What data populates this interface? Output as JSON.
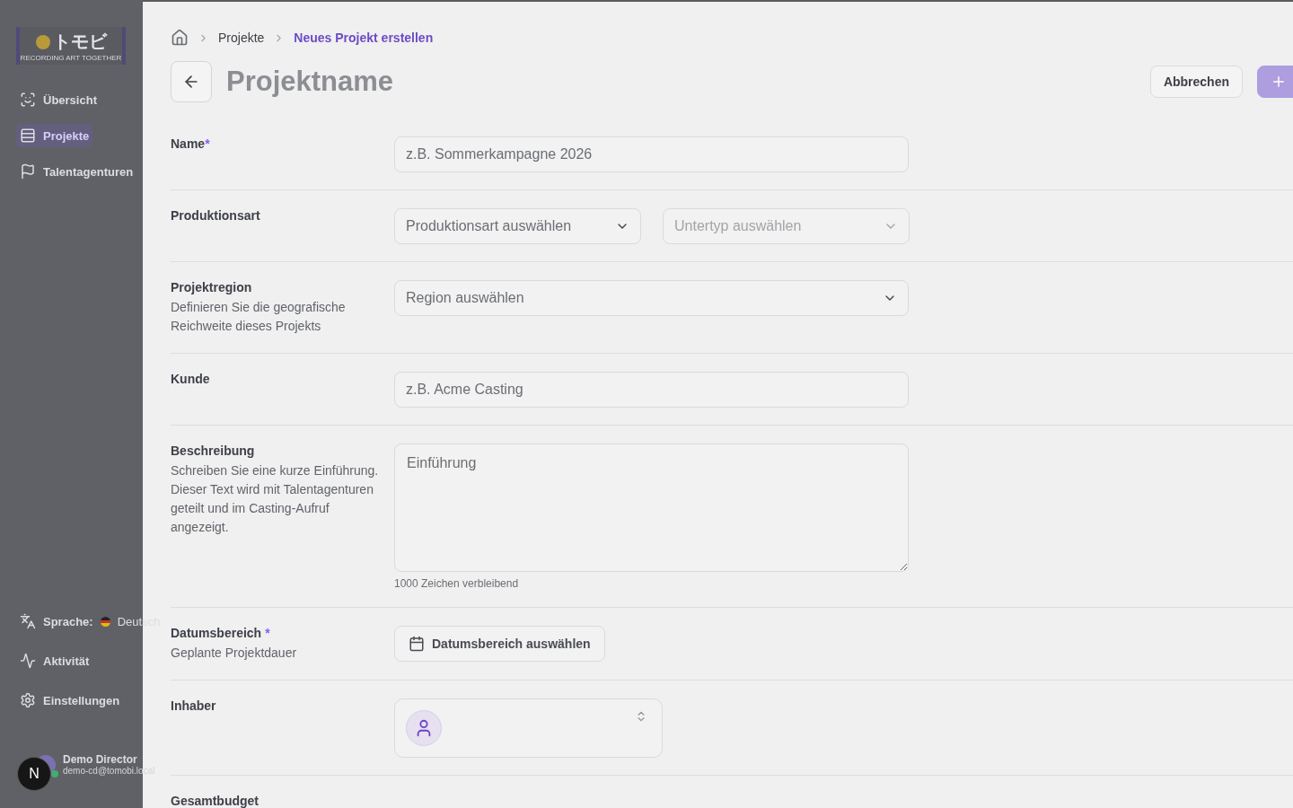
{
  "sidebar": {
    "logo": {
      "mark": "トモビ",
      "tagline": "RECORDING ART TOGETHER"
    },
    "items": [
      {
        "label": "Übersicht",
        "selected": false
      },
      {
        "label": "Projekte",
        "selected": true
      },
      {
        "label": "Talentagenturen",
        "selected": false
      }
    ],
    "footer_items": [
      {
        "label": "Sprache:",
        "value": "Deutsch"
      },
      {
        "label": "Aktivität"
      },
      {
        "label": "Einstellungen"
      }
    ],
    "user": {
      "name": "Demo Director",
      "email": "demo-cd@tomobi.local",
      "online": true
    },
    "dev_badge": "N"
  },
  "panel": {
    "breadcrumb": [
      {
        "label": "Projekte",
        "current": false
      },
      {
        "label": "Neues Projekt erstellen",
        "current": true
      }
    ],
    "title": "Projektname",
    "buttons": [
      {
        "label": "Abbrechen",
        "kind": "secondary"
      },
      {
        "kind": "primary"
      }
    ],
    "rows": [
      {
        "label": "Name",
        "required_mark": "*",
        "kind": "text",
        "fields": [
          {
            "placeholder": "z.B. Sommerkampagne 2026"
          }
        ]
      },
      {
        "label": "Produktionsart",
        "kind": "select",
        "fields": [
          {
            "placeholder": "Produktionsart auswählen",
            "disabled": false
          },
          {
            "placeholder": "Untertyp auswählen",
            "disabled": true
          }
        ]
      },
      {
        "label": "Projektregion",
        "description": "Definieren Sie die geografische Reichweite dieses Projekts",
        "kind": "select",
        "fields": [
          {
            "placeholder": "Region auswählen",
            "disabled": false
          }
        ]
      },
      {
        "label": "Kunde",
        "kind": "text",
        "fields": [
          {
            "placeholder": "z.B. Acme Casting"
          }
        ]
      },
      {
        "label": "Beschreibung",
        "description": "Schreiben Sie eine kurze Einführung. Dieser Text wird mit Talentagenturen geteilt und im Casting-Aufruf angezeigt.",
        "kind": "textarea",
        "fields": [
          {
            "placeholder": "Einführung"
          }
        ],
        "counter": "1000 Zeichen verbleibend"
      },
      {
        "label": "Datumsbereich",
        "required_mark": "*",
        "description": "Geplante Projektdauer",
        "kind": "date",
        "fields": [
          {
            "placeholder": "Datumsbereich auswählen"
          }
        ]
      },
      {
        "label": "Inhaber",
        "kind": "owner"
      },
      {
        "label": "Gesamtbudget",
        "kind": "none"
      }
    ]
  }
}
